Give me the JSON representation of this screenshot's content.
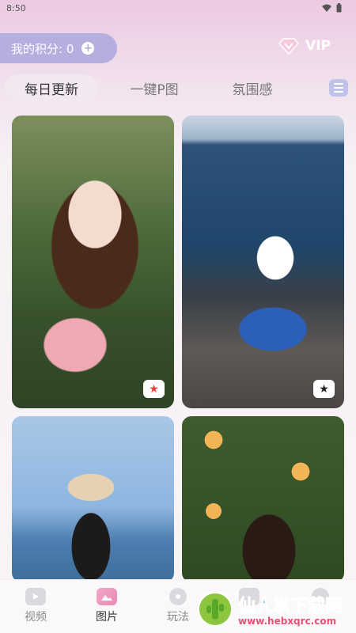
{
  "status": {
    "time": "8:50"
  },
  "header": {
    "points_label": "我的积分: 0",
    "vip_label": "VIP"
  },
  "tabs": [
    {
      "label": "每日更新",
      "active": true
    },
    {
      "label": "一键P图",
      "active": false
    },
    {
      "label": "氛围感",
      "active": false
    }
  ],
  "cards": [
    {
      "badge_icon": "star-icon",
      "badge_color": "#e0443c"
    },
    {
      "badge_icon": "star-icon",
      "badge_color": "#222222"
    },
    {},
    {}
  ],
  "nav": [
    {
      "label": "视频",
      "icon": "video-icon",
      "active": false
    },
    {
      "label": "图片",
      "icon": "image-icon",
      "active": true
    },
    {
      "label": "玩法",
      "icon": "play-icon",
      "active": false
    },
    {
      "label": "",
      "icon": "grid-icon",
      "active": false
    },
    {
      "label": "",
      "icon": "user-icon",
      "active": false
    }
  ],
  "watermark": {
    "main": "仙人掌下载网",
    "sub": "www.hebxqrc.com"
  },
  "colors": {
    "accent": "#b7aee0",
    "pink": "#ecc9e3"
  }
}
